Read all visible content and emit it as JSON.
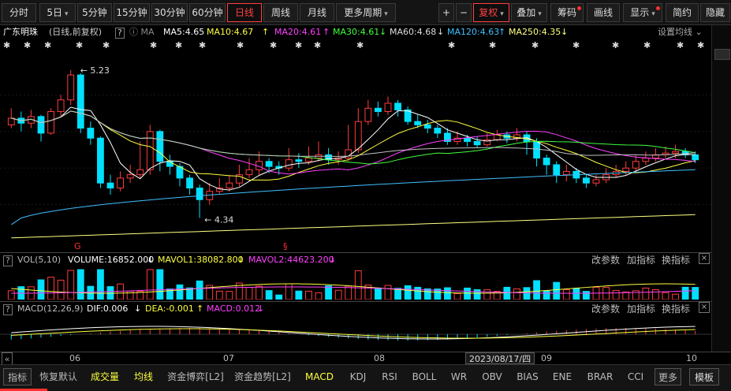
{
  "toolbar": {
    "periods": [
      "分时",
      "5日",
      "5分钟",
      "15分钟",
      "30分钟",
      "60分钟",
      "日线",
      "周线",
      "月线",
      "更多周期"
    ],
    "active_period": "日线",
    "plus": "+",
    "minus": "−",
    "adjust": "复权",
    "overlay": "叠加",
    "chips": "筹码",
    "draw": "画线",
    "display": "显示",
    "simple": "简约",
    "hide": "隐藏"
  },
  "info": {
    "stock": "广东明珠",
    "mode": "(日线,前复权)",
    "help": "?",
    "ma_label": "MA",
    "ma5": "MA5:4.65",
    "ma10": "MA10:4.67",
    "ma20": "MA20:4.61",
    "ma30": "MA30:4.61",
    "ma60": "MA60:4.68",
    "ma120": "MA120:4.63",
    "ma250": "MA250:4.35",
    "settings": "设置均线"
  },
  "chart_data": {
    "type": "candlestick",
    "ylim": [
      4.2,
      5.3
    ],
    "high_label": "5.23",
    "low_label": "4.34",
    "candles": [
      [
        4.9,
        4.94,
        5.0,
        4.88
      ],
      [
        4.94,
        4.91,
        4.98,
        4.86
      ],
      [
        4.91,
        4.95,
        4.99,
        4.88
      ],
      [
        4.95,
        4.85,
        4.96,
        4.8
      ],
      [
        4.85,
        4.98,
        5.0,
        4.84
      ],
      [
        4.98,
        5.05,
        5.08,
        4.95
      ],
      [
        5.05,
        5.2,
        5.23,
        5.02
      ],
      [
        5.2,
        4.88,
        5.21,
        4.85
      ],
      [
        4.88,
        4.82,
        4.92,
        4.78
      ],
      [
        4.82,
        4.55,
        4.83,
        4.52
      ],
      [
        4.55,
        4.52,
        4.6,
        4.48
      ],
      [
        4.52,
        4.58,
        4.62,
        4.5
      ],
      [
        4.58,
        4.6,
        4.66,
        4.55
      ],
      [
        4.6,
        4.63,
        4.8,
        4.58
      ],
      [
        4.63,
        4.86,
        4.9,
        4.6
      ],
      [
        4.86,
        4.68,
        4.87,
        4.62
      ],
      [
        4.68,
        4.65,
        4.72,
        4.6
      ],
      [
        4.65,
        4.58,
        4.67,
        4.53
      ],
      [
        4.58,
        4.52,
        4.6,
        4.48
      ],
      [
        4.52,
        4.45,
        4.54,
        4.34
      ],
      [
        4.45,
        4.5,
        4.55,
        4.42
      ],
      [
        4.5,
        4.52,
        4.58,
        4.48
      ],
      [
        4.52,
        4.55,
        4.6,
        4.5
      ],
      [
        4.55,
        4.6,
        4.66,
        4.53
      ],
      [
        4.6,
        4.63,
        4.7,
        4.58
      ],
      [
        4.63,
        4.68,
        4.74,
        4.6
      ],
      [
        4.68,
        4.65,
        4.7,
        4.61
      ],
      [
        4.65,
        4.64,
        4.68,
        4.6
      ],
      [
        4.64,
        4.69,
        4.76,
        4.62
      ],
      [
        4.69,
        4.68,
        4.73,
        4.64
      ],
      [
        4.68,
        4.7,
        4.77,
        4.66
      ],
      [
        4.7,
        4.72,
        4.8,
        4.68
      ],
      [
        4.72,
        4.69,
        4.76,
        4.66
      ],
      [
        4.69,
        4.7,
        4.74,
        4.66
      ],
      [
        4.7,
        4.75,
        4.9,
        4.68
      ],
      [
        4.75,
        4.92,
        5.0,
        4.73
      ],
      [
        4.92,
        5.0,
        5.05,
        4.9
      ],
      [
        5.0,
        4.98,
        5.04,
        4.95
      ],
      [
        4.98,
        5.03,
        5.07,
        4.96
      ],
      [
        5.03,
        4.99,
        5.05,
        4.95
      ],
      [
        4.99,
        4.92,
        5.01,
        4.9
      ],
      [
        4.92,
        4.9,
        4.96,
        4.88
      ],
      [
        4.9,
        4.88,
        4.93,
        4.85
      ],
      [
        4.88,
        4.85,
        4.9,
        4.82
      ],
      [
        4.85,
        4.8,
        4.88,
        4.78
      ],
      [
        4.8,
        4.82,
        4.86,
        4.78
      ],
      [
        4.82,
        4.8,
        4.84,
        4.77
      ],
      [
        4.8,
        4.78,
        4.83,
        4.76
      ],
      [
        4.78,
        4.81,
        4.85,
        4.77
      ],
      [
        4.81,
        4.84,
        4.87,
        4.8
      ],
      [
        4.84,
        4.82,
        4.86,
        4.79
      ],
      [
        4.82,
        4.84,
        4.88,
        4.8
      ],
      [
        4.84,
        4.8,
        4.86,
        4.72
      ],
      [
        4.8,
        4.7,
        4.82,
        4.65
      ],
      [
        4.7,
        4.66,
        4.72,
        4.6
      ],
      [
        4.66,
        4.6,
        4.68,
        4.55
      ],
      [
        4.6,
        4.62,
        4.66,
        4.56
      ],
      [
        4.62,
        4.58,
        4.64,
        4.55
      ],
      [
        4.58,
        4.55,
        4.6,
        4.52
      ],
      [
        4.55,
        4.57,
        4.6,
        4.53
      ],
      [
        4.57,
        4.6,
        4.64,
        4.55
      ],
      [
        4.6,
        4.62,
        4.66,
        4.58
      ],
      [
        4.62,
        4.64,
        4.68,
        4.6
      ],
      [
        4.64,
        4.68,
        4.72,
        4.62
      ],
      [
        4.68,
        4.7,
        4.74,
        4.66
      ],
      [
        4.7,
        4.72,
        4.76,
        4.68
      ],
      [
        4.72,
        4.73,
        4.77,
        4.7
      ],
      [
        4.73,
        4.74,
        4.78,
        4.7
      ],
      [
        4.74,
        4.72,
        4.76,
        4.7
      ],
      [
        4.72,
        4.69,
        4.74,
        4.67
      ]
    ],
    "ma_colors": {
      "ma5": "#ffffff",
      "ma10": "#ffff40",
      "ma20": "#ff40ff",
      "ma30": "#40ff40",
      "ma60": "#c0c0c0",
      "ma120": "#40c0ff",
      "ma250": "#ffff80"
    }
  },
  "vol": {
    "title": "VOL(5,10)",
    "volume": "VOLUME:16852.000",
    "mavol1": "MAVOL1:38082.800",
    "mavol2": "MAVOL2:44623.200",
    "btn_params": "改参数",
    "btn_add": "加指标",
    "btn_switch": "换指标",
    "close": "×"
  },
  "macd": {
    "title": "MACD(12,26,9)",
    "dif": "DIF:0.006",
    "dea": "DEA:-0.001",
    "macd": "MACD:0.012",
    "btn_params": "改参数",
    "btn_add": "加指标",
    "btn_switch": "换指标",
    "close": "×"
  },
  "datebar": {
    "months": [
      "06",
      "07",
      "08",
      "09",
      "10"
    ],
    "current_date": "2023/08/17/四",
    "left_arrow": "«"
  },
  "bottom": {
    "items": [
      "指标",
      "恢复默认",
      "成交量",
      "均线",
      "资金博弈[L2]",
      "资金趋势[L2]",
      "MACD",
      "KDJ",
      "RSI",
      "BOLL",
      "WR",
      "OBV",
      "BIAS",
      "ENE",
      "BRAR",
      "CCI"
    ],
    "more": "更多",
    "template": "模板"
  },
  "colors": {
    "up": "#ff3c3c",
    "down": "#00e0ff",
    "bg": "#000000"
  }
}
